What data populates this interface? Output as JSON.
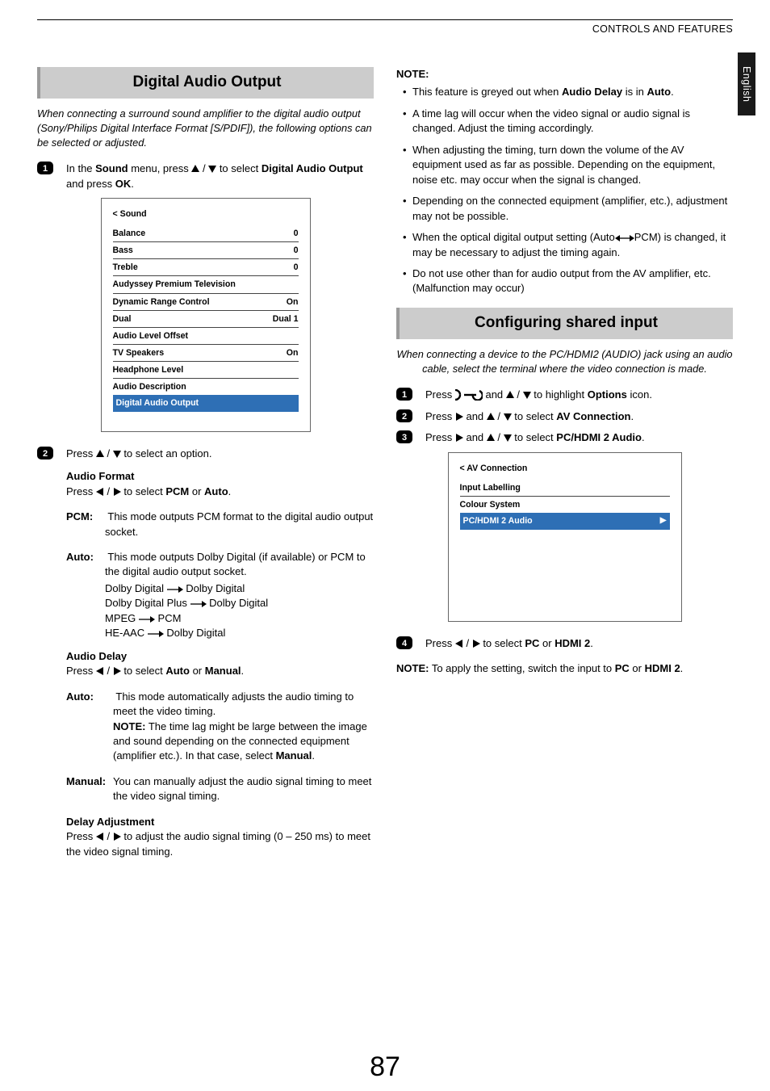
{
  "header": {
    "section": "CONTROLS AND FEATURES",
    "lang": "English"
  },
  "page_number": "87",
  "left": {
    "heading": "Digital Audio Output",
    "intro": "When connecting a surround sound amplifier to the digital audio output (Sony/Philips Digital Interface Format [S/PDIF]), the following options can be selected or adjusted.",
    "step1_a": "In the ",
    "step1_b": "Sound",
    "step1_c": " menu, press ",
    "step1_d": " to select ",
    "step1_e": "Digital Audio Output",
    "step1_f": " and press ",
    "step1_g": "OK",
    "step1_h": ".",
    "osd1": {
      "title": "< Sound",
      "rows": [
        {
          "label": "Balance",
          "val": "0"
        },
        {
          "label": "Bass",
          "val": "0"
        },
        {
          "label": "Treble",
          "val": "0"
        },
        {
          "label": "Audyssey Premium Television",
          "val": ""
        },
        {
          "label": "Dynamic Range Control",
          "val": "On"
        },
        {
          "label": "Dual",
          "val": "Dual 1"
        },
        {
          "label": "Audio Level Offset",
          "val": ""
        },
        {
          "label": "TV Speakers",
          "val": "On"
        },
        {
          "label": "Headphone Level",
          "val": ""
        },
        {
          "label": "Audio Description",
          "val": ""
        }
      ],
      "highlight": "Digital Audio Output"
    },
    "step2": "Press ",
    "step2b": " to select an option.",
    "af_head": "Audio Format",
    "af_line_a": "Press ",
    "af_line_b": " to select ",
    "af_line_c": "PCM",
    "af_line_d": " or ",
    "af_line_e": "Auto",
    "af_line_f": ".",
    "pcm_l": "PCM:",
    "pcm_t": " This mode outputs PCM format to the digital audio output socket.",
    "auto_l": "Auto:",
    "auto_t": " This mode outputs Dolby Digital (if available) or PCM to the digital audio output socket.",
    "map1a": "Dolby Digital",
    "map1b": "Dolby Digital",
    "map2a": "Dolby Digital Plus",
    "map2b": "Dolby Digital",
    "map3a": "MPEG",
    "map3b": "PCM",
    "map4a": "HE-AAC",
    "map4b": "Dolby Digital",
    "ad_head": "Audio Delay",
    "ad_line_a": "Press ",
    "ad_line_b": " to select ",
    "ad_line_c": "Auto",
    "ad_line_d": " or ",
    "ad_line_e": "Manual",
    "ad_line_f": ".",
    "ad_auto_l": "Auto:",
    "ad_auto_t": " This mode automatically adjusts the audio timing to meet the video timing.",
    "ad_auto_note_l": "NOTE:",
    "ad_auto_note_t": " The time lag might be large between the image and sound depending on the connected equipment (amplifier etc.). In that case, select ",
    "ad_auto_note_m": "Manual",
    "ad_auto_note_e": ".",
    "ad_man_l": "Manual:",
    "ad_man_t": "You can manually adjust the audio signal timing to meet the video signal timing.",
    "da_head": "Delay Adjustment",
    "da_a": "Press ",
    "da_b": " to adjust the audio signal timing (0 – 250 ms) to meet the video signal timing."
  },
  "right": {
    "note_head": "NOTE:",
    "notes": [
      {
        "a": "This feature is greyed out when ",
        "b": "Audio Delay",
        "c": " is in ",
        "d": "Auto",
        "e": "."
      },
      {
        "a": "A time lag will occur when the video signal or audio signal is changed. Adjust the timing accordingly."
      },
      {
        "a": "When adjusting the timing, turn down the volume of the AV equipment used as far as possible. Depending on the equipment, noise etc. may occur when the signal is changed."
      },
      {
        "a": "Depending on the connected equipment (amplifier, etc.), adjustment may not be possible."
      },
      {
        "a": "When the optical digital output setting (Auto",
        "b": "PCM) is changed, it may be necessary to adjust the timing again."
      },
      {
        "a": "Do not use other than for audio output from the AV amplifier, etc. (Malfunction may occur)"
      }
    ],
    "heading": "Configuring shared input",
    "intro": "When connecting a device to the PC/HDMI2 (AUDIO) jack using an audio cable, select the terminal where the video connection is made.",
    "s1_a": "Press ",
    "s1_b": " and ",
    "s1_c": " to highlight ",
    "s1_d": "Options",
    "s1_e": " icon.",
    "s2_a": "Press ",
    "s2_b": " and  ",
    "s2_c": " to select ",
    "s2_d": "AV Connection",
    "s2_e": ".",
    "s3_a": "Press ",
    "s3_b": " and  ",
    "s3_c": " to select ",
    "s3_d": "PC/HDMI 2 Audio",
    "s3_e": ".",
    "osd2": {
      "title": "< AV Connection",
      "rows": [
        {
          "label": "Input Labelling"
        },
        {
          "label": "Colour System"
        }
      ],
      "highlight": "PC/HDMI 2 Audio"
    },
    "s4_a": "Press ",
    "s4_b": " to select ",
    "s4_c": "PC",
    "s4_d": " or ",
    "s4_e": "HDMI 2",
    "s4_f": ".",
    "foot_a": "NOTE:",
    "foot_b": " To apply the setting, switch the input to ",
    "foot_c": "PC",
    "foot_d": " or ",
    "foot_e": "HDMI 2",
    "foot_f": "."
  }
}
